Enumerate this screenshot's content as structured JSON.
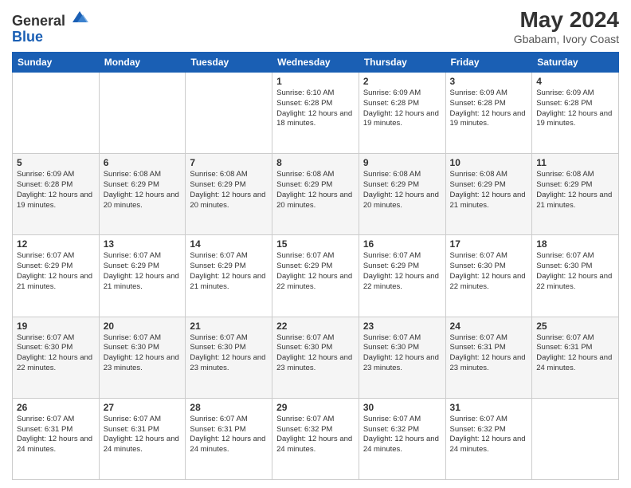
{
  "header": {
    "logo_general": "General",
    "logo_blue": "Blue",
    "month_title": "May 2024",
    "location": "Gbabam, Ivory Coast"
  },
  "days_of_week": [
    "Sunday",
    "Monday",
    "Tuesday",
    "Wednesday",
    "Thursday",
    "Friday",
    "Saturday"
  ],
  "weeks": [
    [
      {
        "day": "",
        "info": ""
      },
      {
        "day": "",
        "info": ""
      },
      {
        "day": "",
        "info": ""
      },
      {
        "day": "1",
        "info": "Sunrise: 6:10 AM\nSunset: 6:28 PM\nDaylight: 12 hours and 18 minutes."
      },
      {
        "day": "2",
        "info": "Sunrise: 6:09 AM\nSunset: 6:28 PM\nDaylight: 12 hours and 19 minutes."
      },
      {
        "day": "3",
        "info": "Sunrise: 6:09 AM\nSunset: 6:28 PM\nDaylight: 12 hours and 19 minutes."
      },
      {
        "day": "4",
        "info": "Sunrise: 6:09 AM\nSunset: 6:28 PM\nDaylight: 12 hours and 19 minutes."
      }
    ],
    [
      {
        "day": "5",
        "info": "Sunrise: 6:09 AM\nSunset: 6:28 PM\nDaylight: 12 hours and 19 minutes."
      },
      {
        "day": "6",
        "info": "Sunrise: 6:08 AM\nSunset: 6:29 PM\nDaylight: 12 hours and 20 minutes."
      },
      {
        "day": "7",
        "info": "Sunrise: 6:08 AM\nSunset: 6:29 PM\nDaylight: 12 hours and 20 minutes."
      },
      {
        "day": "8",
        "info": "Sunrise: 6:08 AM\nSunset: 6:29 PM\nDaylight: 12 hours and 20 minutes."
      },
      {
        "day": "9",
        "info": "Sunrise: 6:08 AM\nSunset: 6:29 PM\nDaylight: 12 hours and 20 minutes."
      },
      {
        "day": "10",
        "info": "Sunrise: 6:08 AM\nSunset: 6:29 PM\nDaylight: 12 hours and 21 minutes."
      },
      {
        "day": "11",
        "info": "Sunrise: 6:08 AM\nSunset: 6:29 PM\nDaylight: 12 hours and 21 minutes."
      }
    ],
    [
      {
        "day": "12",
        "info": "Sunrise: 6:07 AM\nSunset: 6:29 PM\nDaylight: 12 hours and 21 minutes."
      },
      {
        "day": "13",
        "info": "Sunrise: 6:07 AM\nSunset: 6:29 PM\nDaylight: 12 hours and 21 minutes."
      },
      {
        "day": "14",
        "info": "Sunrise: 6:07 AM\nSunset: 6:29 PM\nDaylight: 12 hours and 21 minutes."
      },
      {
        "day": "15",
        "info": "Sunrise: 6:07 AM\nSunset: 6:29 PM\nDaylight: 12 hours and 22 minutes."
      },
      {
        "day": "16",
        "info": "Sunrise: 6:07 AM\nSunset: 6:29 PM\nDaylight: 12 hours and 22 minutes."
      },
      {
        "day": "17",
        "info": "Sunrise: 6:07 AM\nSunset: 6:30 PM\nDaylight: 12 hours and 22 minutes."
      },
      {
        "day": "18",
        "info": "Sunrise: 6:07 AM\nSunset: 6:30 PM\nDaylight: 12 hours and 22 minutes."
      }
    ],
    [
      {
        "day": "19",
        "info": "Sunrise: 6:07 AM\nSunset: 6:30 PM\nDaylight: 12 hours and 22 minutes."
      },
      {
        "day": "20",
        "info": "Sunrise: 6:07 AM\nSunset: 6:30 PM\nDaylight: 12 hours and 23 minutes."
      },
      {
        "day": "21",
        "info": "Sunrise: 6:07 AM\nSunset: 6:30 PM\nDaylight: 12 hours and 23 minutes."
      },
      {
        "day": "22",
        "info": "Sunrise: 6:07 AM\nSunset: 6:30 PM\nDaylight: 12 hours and 23 minutes."
      },
      {
        "day": "23",
        "info": "Sunrise: 6:07 AM\nSunset: 6:30 PM\nDaylight: 12 hours and 23 minutes."
      },
      {
        "day": "24",
        "info": "Sunrise: 6:07 AM\nSunset: 6:31 PM\nDaylight: 12 hours and 23 minutes."
      },
      {
        "day": "25",
        "info": "Sunrise: 6:07 AM\nSunset: 6:31 PM\nDaylight: 12 hours and 24 minutes."
      }
    ],
    [
      {
        "day": "26",
        "info": "Sunrise: 6:07 AM\nSunset: 6:31 PM\nDaylight: 12 hours and 24 minutes."
      },
      {
        "day": "27",
        "info": "Sunrise: 6:07 AM\nSunset: 6:31 PM\nDaylight: 12 hours and 24 minutes."
      },
      {
        "day": "28",
        "info": "Sunrise: 6:07 AM\nSunset: 6:31 PM\nDaylight: 12 hours and 24 minutes."
      },
      {
        "day": "29",
        "info": "Sunrise: 6:07 AM\nSunset: 6:32 PM\nDaylight: 12 hours and 24 minutes."
      },
      {
        "day": "30",
        "info": "Sunrise: 6:07 AM\nSunset: 6:32 PM\nDaylight: 12 hours and 24 minutes."
      },
      {
        "day": "31",
        "info": "Sunrise: 6:07 AM\nSunset: 6:32 PM\nDaylight: 12 hours and 24 minutes."
      },
      {
        "day": "",
        "info": ""
      }
    ]
  ]
}
